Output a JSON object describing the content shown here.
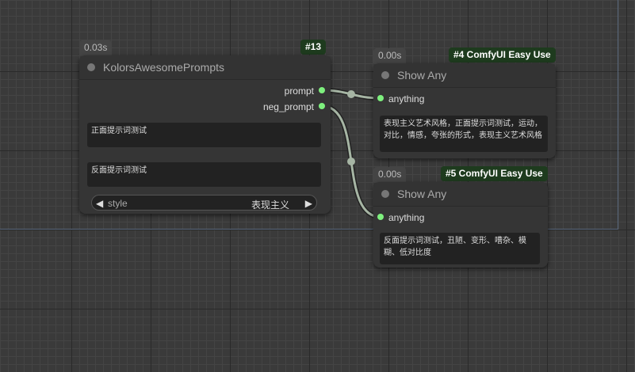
{
  "nodes": {
    "kolors": {
      "time": "0.03s",
      "id": "#13",
      "title": "KolorsAwesomePrompts",
      "outputs": [
        "prompt",
        "neg_prompt"
      ],
      "positive_text": "正面提示词测试",
      "negative_text": "反面提示词测试",
      "style_label": "style",
      "style_value": "表现主义",
      "arrow_left": "◀",
      "arrow_right": "▶"
    },
    "show1": {
      "time": "0.00s",
      "id": "#4 ComfyUI Easy Use",
      "title": "Show Any",
      "input": "anything",
      "output_text": "表现主义艺术风格，正面提示词测试，运动，对比，情感，夸张的形式，表现主义艺术风格"
    },
    "show2": {
      "time": "0.00s",
      "id": "#5 ComfyUI Easy Use",
      "title": "Show Any",
      "input": "anything",
      "output_text": "反面提示词测试，丑陋、变形、嘈杂、模糊、低对比度"
    }
  },
  "colors": {
    "wire": "#a6b5a4",
    "slot_dot": "#7ef07e",
    "id_badge": "#1e3b1e",
    "group_border": "#57667a"
  }
}
